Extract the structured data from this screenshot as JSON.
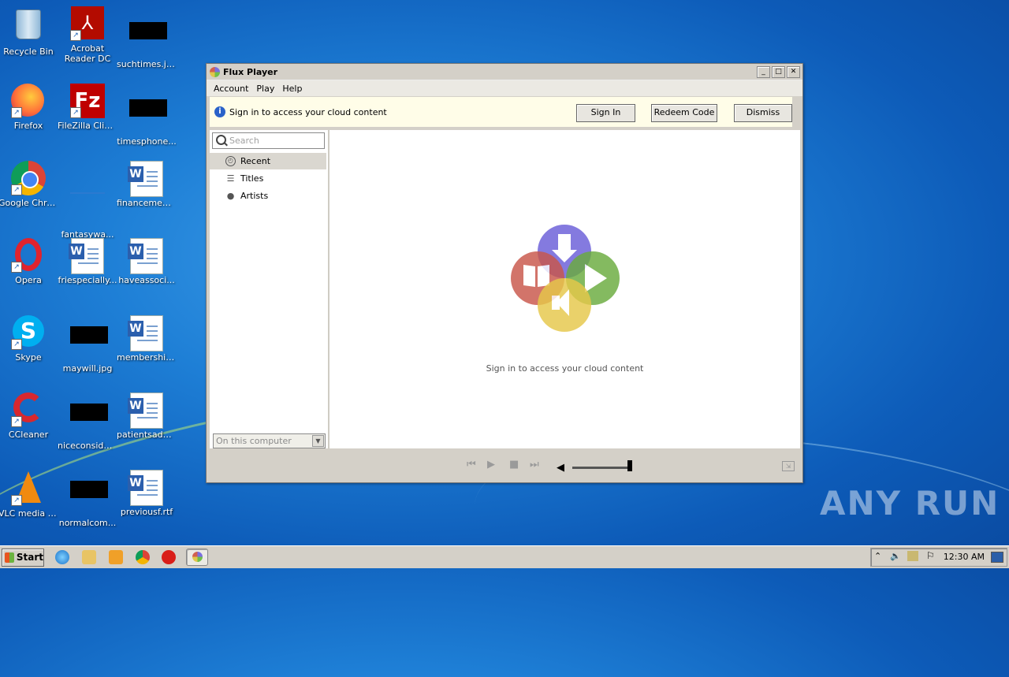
{
  "desktop": {
    "icons": [
      {
        "label": "Recycle Bin"
      },
      {
        "label": "Acrobat Reader DC"
      },
      {
        "label": "suchtimes.jpg"
      },
      {
        "label": "Firefox"
      },
      {
        "label": "FileZilla Client"
      },
      {
        "label": "timesphone..."
      },
      {
        "label": "Google Chrome"
      },
      {
        "label": "fantasywa..."
      },
      {
        "label": "financemem..."
      },
      {
        "label": "Opera"
      },
      {
        "label": "friespecially..."
      },
      {
        "label": "haveassoci..."
      },
      {
        "label": "Skype"
      },
      {
        "label": "maywill.jpg"
      },
      {
        "label": "membership..."
      },
      {
        "label": "CCleaner"
      },
      {
        "label": "niceconsider..."
      },
      {
        "label": "patientsadd..."
      },
      {
        "label": "VLC media player"
      },
      {
        "label": "normalcom..."
      },
      {
        "label": "previousf.rtf"
      }
    ]
  },
  "window": {
    "title": "Flux Player",
    "menu": [
      "Account",
      "Play",
      "Help"
    ],
    "infobar": {
      "message": "Sign in to access your cloud content",
      "sign_in": "Sign In",
      "redeem": "Redeem Code",
      "dismiss": "Dismiss"
    },
    "search_placeholder": "Search",
    "nav": [
      {
        "label": "Recent",
        "icon": "clock-icon",
        "selected": true
      },
      {
        "label": "Titles",
        "icon": "list-icon",
        "selected": false
      },
      {
        "label": "Artists",
        "icon": "person-icon",
        "selected": false
      }
    ],
    "source_select": "On this computer",
    "empty_message": "Sign in to access your cloud content"
  },
  "taskbar": {
    "start": "Start",
    "clock": "12:30 AM"
  },
  "watermark": "ANY RUN"
}
